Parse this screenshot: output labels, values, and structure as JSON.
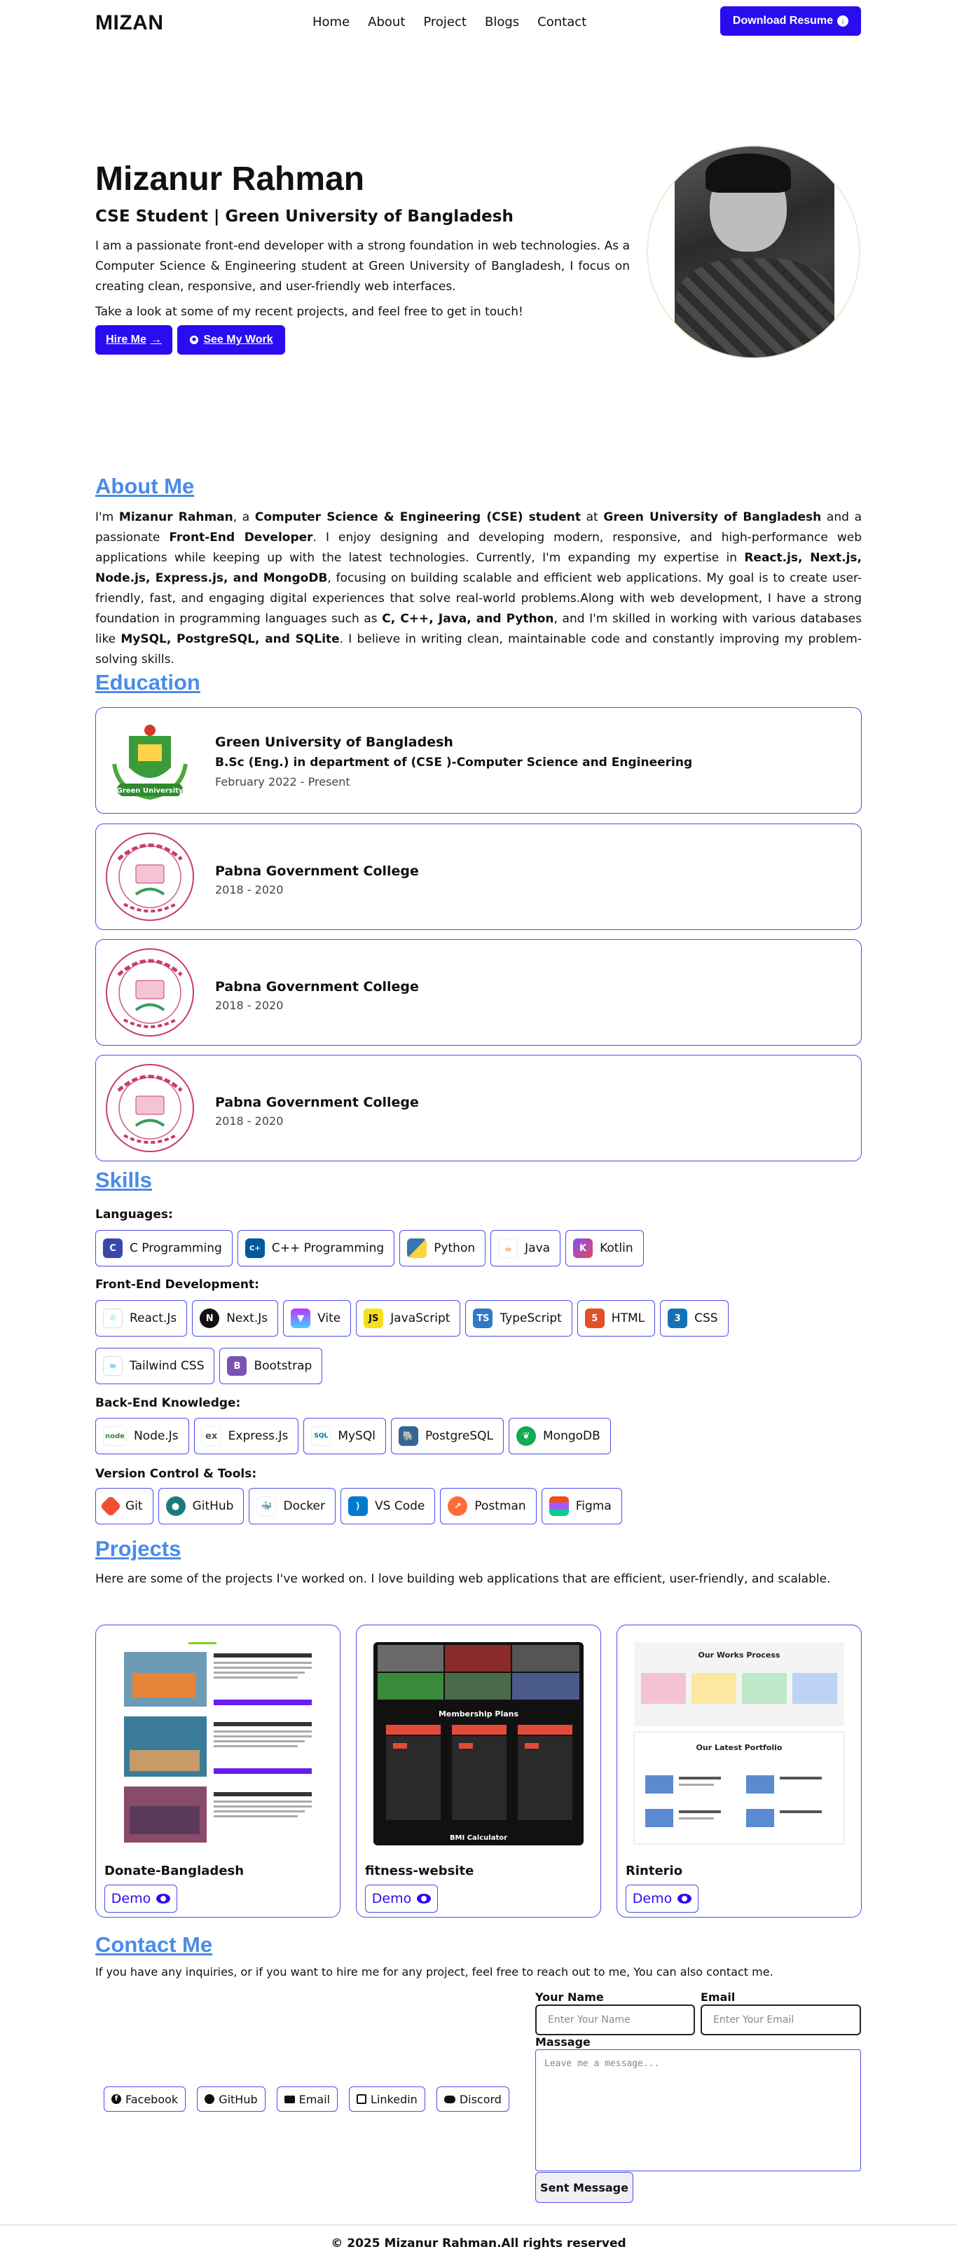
{
  "nav": {
    "logo": "MIZAN",
    "links": [
      "Home",
      "About",
      "Project",
      "Blogs",
      "Contact"
    ],
    "download_label": "Download Resume"
  },
  "hero": {
    "name": "Mizanur Rahman",
    "subtitle": "CSE Student | Green University of Bangladesh",
    "intro": "I am a passionate front-end developer with a strong foundation in web technologies. As a Computer Science & Engineering student at Green University of Bangladesh, I focus on creating clean, responsive, and user-friendly web interfaces.",
    "cta_text": "Take a look at some of my recent projects, and feel free to get in touch!",
    "hire_label": "Hire Me",
    "work_label": "See My Work"
  },
  "about": {
    "heading": "About Me",
    "p1": "I'm ",
    "b1": "Mizanur Rahman",
    "p2": ", a ",
    "b2": "Computer Science & Engineering (CSE) student",
    "p3": " at ",
    "b3": "Green University of Bangladesh",
    "p4": " and a passionate ",
    "b4": "Front-End Developer",
    "p5": ". I enjoy designing and developing modern, responsive, and high-performance web applications while keeping up with the latest technologies. Currently, I'm expanding my expertise in ",
    "b5": "React.js, Next.js, Node.js, Express.js, and MongoDB",
    "p6": ", focusing on building scalable and efficient web applications. My goal is to create user-friendly, fast, and engaging digital experiences that solve real-world problems.Along with web development, I have a strong foundation in programming languages such as ",
    "b6": "C, C++, Java, and Python",
    "p7": ", and I'm skilled in working with various databases like ",
    "b7": "MySQL, PostgreSQL, and SQLite",
    "p8": ". I believe in writing clean, maintainable code and constantly improving my problem-solving skills."
  },
  "education": {
    "heading": "Education",
    "items": [
      {
        "school": "Green University of Bangladesh",
        "degree": "B.Sc (Eng.) in department of (CSE )-Computer Science and Engineering",
        "dates": "February 2022 - Present",
        "logo_text": "Green University"
      },
      {
        "school": "Pabna Government College",
        "dates": "2018 - 2020"
      },
      {
        "school": "Pabna Government College",
        "dates": "2018 - 2020"
      },
      {
        "school": "Pabna Government College",
        "dates": "2018 - 2020"
      }
    ]
  },
  "skills": {
    "heading": "Skills",
    "languages_label": "Languages:",
    "languages": [
      "C Programming",
      "C++ Programming",
      "Python",
      "Java",
      "Kotlin"
    ],
    "frontend_label": "Front-End Development:",
    "frontend": [
      "React.Js",
      "Next.Js",
      "Vite",
      "JavaScript",
      "TypeScript",
      "HTML",
      "CSS"
    ],
    "frontend2": [
      "Tailwind CSS",
      "Bootstrap"
    ],
    "backend_label": "Back-End Knowledge:",
    "backend": [
      "Node.Js",
      "Express.Js",
      "MySQl",
      "PostgreSQL",
      "MongoDB"
    ],
    "tools_label": "Version Control & Tools:",
    "tools": [
      "Git",
      "GitHub",
      "Docker",
      "VS Code",
      "Postman",
      "Figma"
    ]
  },
  "projects": {
    "heading": "Projects",
    "intro": "Here are some of the projects I've worked on. I love building web applications that are efficient, user-friendly, and scalable.",
    "items": [
      {
        "title": "Donate-Bangladesh",
        "demo": "Demo"
      },
      {
        "title": "fitness-website",
        "demo": "Demo",
        "shot_title": "Membership Plans",
        "shot_footer": "BMI Calculator"
      },
      {
        "title": "Rinterio",
        "demo": "Demo",
        "shot_title": "Our Works Process",
        "shot_title2": "Our Latest Portfolio"
      }
    ]
  },
  "contact": {
    "heading": "Contact Me",
    "intro": "If you have any inquiries, or if you want to hire me for any project, feel free to reach out to me, You can also contact me.",
    "socials": [
      "Facebook",
      "GitHub",
      "Email",
      "Linkedin",
      "Discord"
    ],
    "name_label": "Your Name",
    "name_placeholder": "Enter Your Name",
    "email_label": "Email",
    "email_placeholder": "Enter Your Email",
    "message_label": "Massage",
    "message_placeholder": "Leave me a message...",
    "send_label": "Sent Message"
  },
  "footer": "© 2025 Mizanur Rahman.All rights reserved",
  "colors": {
    "accent": "#2a0cf0",
    "heading": "#4a8ce8",
    "border": "#4b4cf0"
  }
}
